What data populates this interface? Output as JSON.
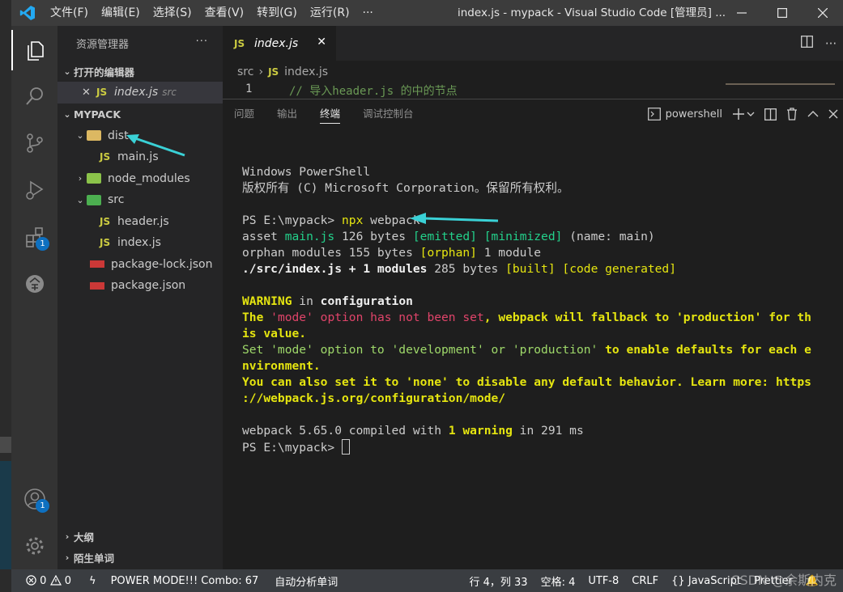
{
  "window": {
    "title": "index.js - mypack - Visual Studio Code [管理员] ...",
    "menu": [
      "文件(F)",
      "编辑(E)",
      "选择(S)",
      "查看(V)",
      "转到(G)",
      "运行(R)",
      "···"
    ]
  },
  "activity_bar": {
    "extensions_badge": "1",
    "accounts_badge": "1"
  },
  "sidebar": {
    "title": "资源管理器",
    "more": "···",
    "open_editors_title": "打开的编辑器",
    "open_editor": {
      "name": "index.js",
      "folder": "src",
      "icon": "JS"
    },
    "project_title": "MYPACK",
    "tree": [
      {
        "label": "dist",
        "icon": "JS"
      },
      {
        "label": "main.js",
        "icon": "JS"
      },
      {
        "label": "node_modules"
      },
      {
        "label": "src"
      },
      {
        "label": "header.js",
        "icon": "JS"
      },
      {
        "label": "index.js",
        "icon": "JS"
      },
      {
        "label": "package-lock.json"
      },
      {
        "label": "package.json"
      }
    ],
    "outline_title": "大纲",
    "vocab_title": "陌生单词"
  },
  "editor": {
    "tab_label": "index.js",
    "tab_icon": "JS",
    "breadcrumb": {
      "folder": "src",
      "file": "index.js",
      "icon": "JS"
    },
    "line_number": "1",
    "line_text": "// 导入header.js 的中的节点"
  },
  "panel": {
    "tabs": [
      "问题",
      "输出",
      "终端",
      "调试控制台"
    ],
    "active_tab": "终端",
    "shell": "powershell",
    "terminal": {
      "l1": "Windows PowerShell",
      "l2": "版权所有 (C) Microsoft Corporation。保留所有权利。",
      "prompt": "PS E:\\mypack> ",
      "cmd_npx": "npx",
      "cmd_rest": " webpack",
      "a_asset": "asset ",
      "a_file": "main.js",
      "a_bytes": " 126 bytes ",
      "a_emitted": "[emitted]",
      "a_sp": " ",
      "a_min": "[minimized]",
      "a_name": " (name: main)",
      "o_pre": "orphan modules 155 bytes ",
      "o_tag": "[orphan]",
      "o_post": " 1 module",
      "s_pre": "./src/index.js + 1 modules",
      "s_bytes": " 285 bytes ",
      "s_built": "[built]",
      "s_sp": " ",
      "s_gen": "[code generated]",
      "w_label": "WARNING",
      "w_in": " in ",
      "w_config": "configuration",
      "m1_the": "The ",
      "m1_mode": "'mode' option has not been set",
      "m1_rest": ", webpack will fallback to 'production' for th",
      "m2": "is value.",
      "m3_set": "Set 'mode' option to 'development' or 'production'",
      "m3_rest": " to enable defaults for each e",
      "m4": "nvironment.",
      "m5": "You can also set it to 'none' to disable any default behavior. Learn more: https",
      "m6": "://webpack.js.org/configuration/mode/",
      "c_pre": "webpack 5.65.0 compiled with ",
      "c_warn": "1 warning",
      "c_post": " in 291 ms",
      "prompt2": "PS E:\\mypack> "
    }
  },
  "statusbar": {
    "errors": "0",
    "warnings": "0",
    "power_mode": "POWER MODE!!! Combo: 67",
    "auto_analyze": "自动分析单词",
    "position": "行 4，列 33",
    "spaces": "空格: 4",
    "encoding": "UTF-8",
    "eol": "CRLF",
    "language": "JavaScript",
    "prettier": "Prettier",
    "watermark": "CSDN @余斯内克"
  },
  "colors": {
    "titlebar": "#3c3c3c",
    "activity": "#333333",
    "sidebar": "#252526",
    "editor": "#1e1e1e",
    "statusbar": "#3a3d41",
    "arrow": "#3ad1d6",
    "js_yellow": "#cbcb41"
  }
}
